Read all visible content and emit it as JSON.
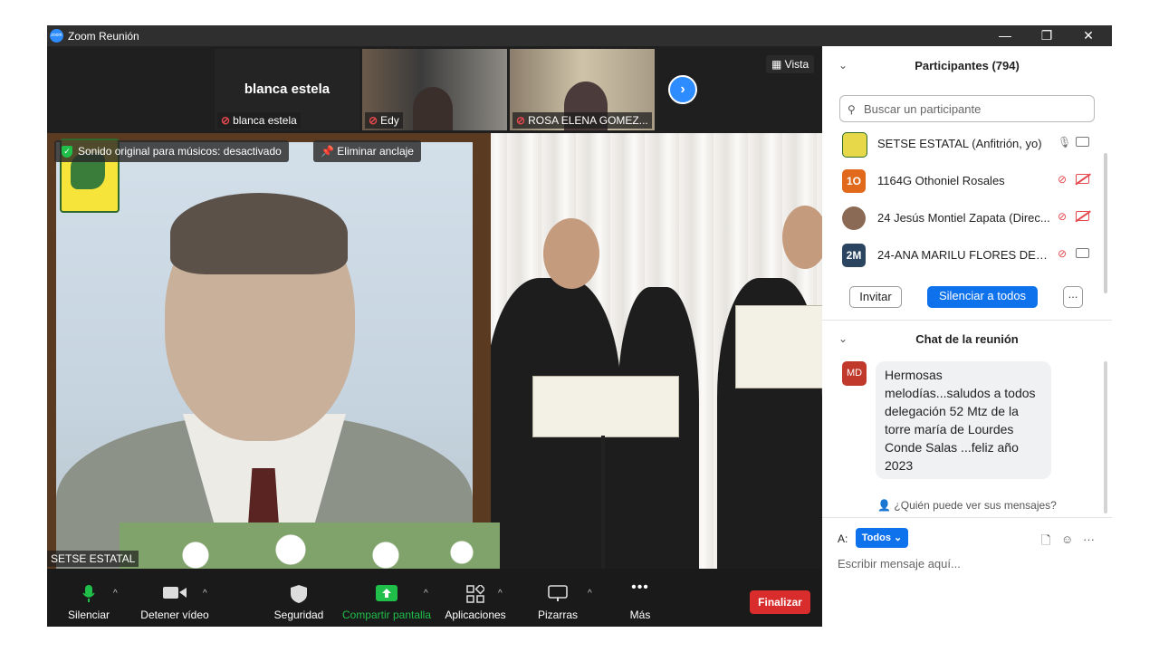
{
  "window": {
    "title": "Zoom Reunión",
    "logo_text": "zoom"
  },
  "window_controls": {
    "minimize": "—",
    "restore": "❐",
    "close": "✕"
  },
  "top_tiles": [
    {
      "big_name": "blanca estela",
      "label": "blanca estela"
    },
    {
      "label": "Edy"
    },
    {
      "label": "ROSA ELENA GOMEZ..."
    }
  ],
  "next_icon": "›",
  "view_button": "Vista",
  "overlays": {
    "original_sound": "Sonido original para músicos: desactivado",
    "unpin": "Eliminar anclaje"
  },
  "main_speaker_name": "SETSE ESTATAL",
  "toolbar": {
    "mute": "Silenciar",
    "video": "Detener vídeo",
    "security": "Seguridad",
    "share": "Compartir pantalla",
    "apps": "Aplicaciones",
    "whiteboards": "Pizarras",
    "more": "Más",
    "end": "Finalizar"
  },
  "participants": {
    "title": "Participantes (794)",
    "search_placeholder": "Buscar un participante",
    "list": [
      {
        "avatar": "",
        "name": "SETSE ESTATAL (Anfitrión, yo)",
        "muted": false,
        "video_off": false,
        "color": "#e7d84a"
      },
      {
        "avatar": "1O",
        "name": "1164G Othoniel Rosales",
        "muted": true,
        "video_off": true,
        "color": "#e0691b"
      },
      {
        "avatar": "",
        "name": "24 Jesús Montiel Zapata (Direc...",
        "muted": true,
        "video_off": true,
        "color": "#8a6a55"
      },
      {
        "avatar": "2M",
        "name": "24-ANA MARILU FLORES DEL A...",
        "muted": true,
        "video_off": false,
        "color": "#2b4560"
      }
    ],
    "invite": "Invitar",
    "mute_all": "Silenciar a todos",
    "more": "..."
  },
  "chat": {
    "title": "Chat de la reunión",
    "messages": [
      {
        "avatar": "MD",
        "text": "Hermosas melodías...saludos a todos delegación 52 Mtz de la torre maría de Lourdes Conde Salas ...feliz año 2023"
      }
    ],
    "who_can_see": "¿Quién puede ver sus mensajes?",
    "to_label": "A:",
    "to_value": "Todos",
    "compose_placeholder": "Escribir mensaje aquí..."
  }
}
